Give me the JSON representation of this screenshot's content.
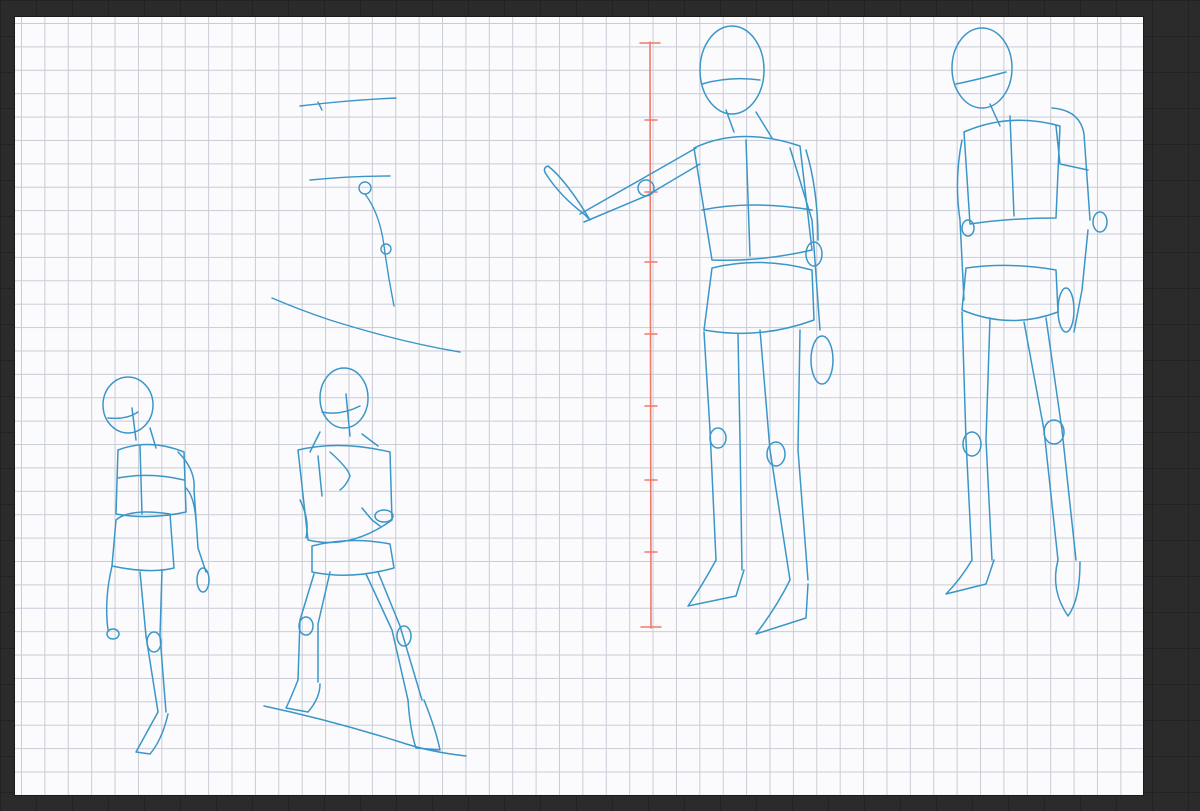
{
  "app": {
    "view": "drawing-canvas"
  },
  "colors": {
    "workspace_bg": "#2b2b2b",
    "canvas_bg": "#fbfbfd",
    "grid_line": "#c9ccd6",
    "sketch_stroke": "#3b96c8",
    "guide_stroke": "#f07a6a"
  },
  "canvas": {
    "layers": [
      {
        "name": "figure-sketches"
      },
      {
        "name": "height-guide"
      }
    ]
  }
}
